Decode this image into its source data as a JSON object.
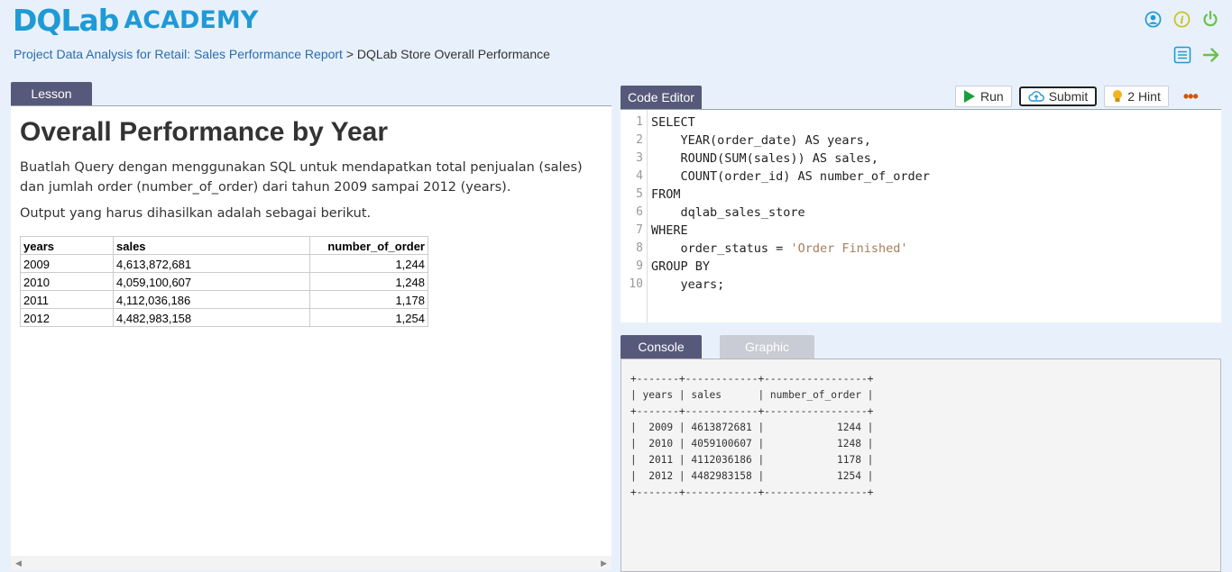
{
  "brand": {
    "logo_text_1": "DQLab",
    "logo_text_2": "ACADEMY",
    "color": "#1f9ad6"
  },
  "header": {
    "icons": [
      "user-icon",
      "info-icon",
      "power-icon"
    ]
  },
  "breadcrumb": {
    "parent": "Project Data Analysis for Retail: Sales Performance Report",
    "separator": ">",
    "current": "DQLab Store Overall Performance"
  },
  "nav": {
    "icons": [
      "list-icon",
      "next-arrow-icon"
    ]
  },
  "lesson": {
    "tab_label": "Lesson",
    "title": "Overall Performance by Year",
    "paragraph_1": "Buatlah Query dengan menggunakan SQL untuk mendapatkan total penjualan (sales) dan jumlah order (number_of_order) dari tahun 2009 sampai 2012 (years).",
    "paragraph_2": "Output yang harus dihasilkan adalah sebagai berikut.",
    "table": {
      "headers": [
        "years",
        "sales",
        "number_of_order"
      ],
      "rows": [
        [
          "2009",
          "4,613,872,681",
          "1,244"
        ],
        [
          "2010",
          "4,059,100,607",
          "1,248"
        ],
        [
          "2011",
          "4,112,036,186",
          "1,178"
        ],
        [
          "2012",
          "4,482,983,158",
          "1,254"
        ]
      ]
    }
  },
  "editor": {
    "tab_label": "Code Editor",
    "run_label": "Run",
    "submit_label": "Submit",
    "hint_label": "2 Hint",
    "more_label": "•••",
    "lines": [
      "SELECT",
      "    YEAR(order_date) AS years,",
      "    ROUND(SUM(sales)) AS sales,",
      "    COUNT(order_id) AS number_of_order",
      "FROM",
      "    dqlab_sales_store",
      "WHERE",
      "    order_status = ",
      "GROUP BY",
      "    years;"
    ],
    "line_8_string": "'Order Finished'",
    "line_numbers": [
      "1",
      "2",
      "3",
      "4",
      "5",
      "6",
      "7",
      "8",
      "9",
      "10"
    ]
  },
  "console": {
    "tab_label": "Console",
    "graphic_label": "Graphic",
    "output": "+-------+------------+-----------------+\n| years | sales      | number_of_order |\n+-------+------------+-----------------+\n|  2009 | 4613872681 |            1244 |\n|  2010 | 4059100607 |            1248 |\n|  2011 | 4112036186 |            1178 |\n|  2012 | 4482983158 |            1254 |\n+-------+------------+-----------------+"
  }
}
